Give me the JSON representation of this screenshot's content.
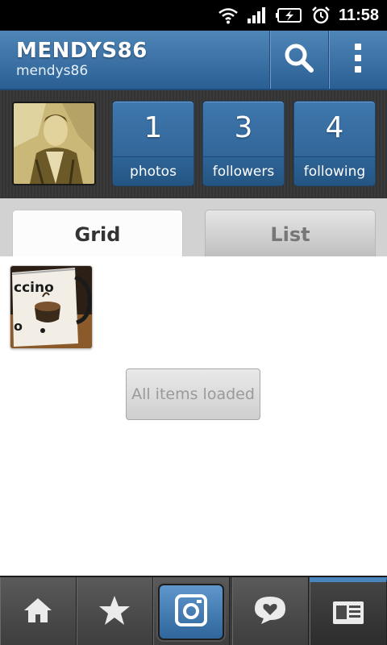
{
  "status_bar": {
    "time": "11:58",
    "icons": [
      "wifi-icon",
      "signal-icon",
      "battery-charging-icon",
      "alarm-icon"
    ]
  },
  "header": {
    "title": "MENDYS86",
    "subtitle": "mendys86",
    "actions": [
      "search-icon",
      "overflow-menu-icon"
    ]
  },
  "profile": {
    "stats": [
      {
        "count": "1",
        "label": "photos"
      },
      {
        "count": "3",
        "label": "followers"
      },
      {
        "count": "4",
        "label": "following"
      }
    ]
  },
  "tabs": [
    {
      "label": "Grid",
      "selected": true
    },
    {
      "label": "List",
      "selected": false
    }
  ],
  "content": {
    "status_button": "All items loaded"
  },
  "bottom_nav": {
    "items": [
      "home-icon",
      "star-icon",
      "camera-icon",
      "speech-heart-icon",
      "profile-card-icon"
    ],
    "active": "profile-card-icon"
  },
  "colors": {
    "accent": "#2f6497",
    "header_top": "#4f86b8",
    "nav_bg": "#3a3a3a"
  }
}
